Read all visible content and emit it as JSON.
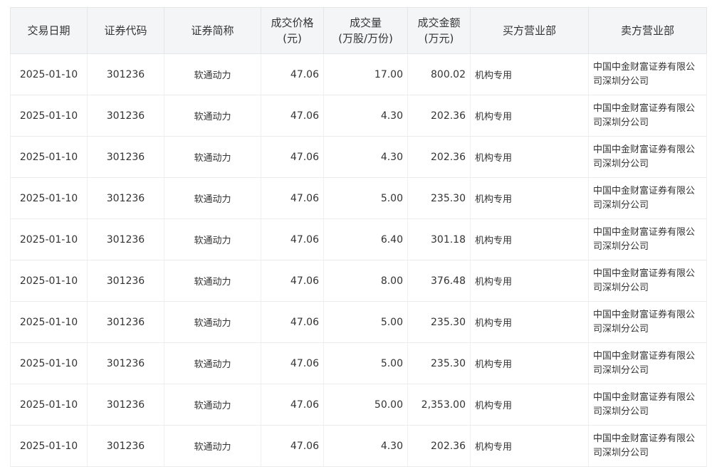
{
  "table": {
    "headers": [
      {
        "line1": "交易日期",
        "line2": ""
      },
      {
        "line1": "证券代码",
        "line2": ""
      },
      {
        "line1": "证券简称",
        "line2": ""
      },
      {
        "line1": "成交价格",
        "line2": "(元)"
      },
      {
        "line1": "成交量",
        "line2": "(万股/万份)"
      },
      {
        "line1": "成交金额",
        "line2": "(万元)"
      },
      {
        "line1": "买方营业部",
        "line2": ""
      },
      {
        "line1": "卖方营业部",
        "line2": ""
      }
    ],
    "rows": [
      {
        "date": "2025-01-10",
        "code": "301236",
        "name": "软通动力",
        "price": "47.06",
        "volume": "17.00",
        "amount": "800.02",
        "buyer": "机构专用",
        "seller": "中国中金财富证券有限公司深圳分公司"
      },
      {
        "date": "2025-01-10",
        "code": "301236",
        "name": "软通动力",
        "price": "47.06",
        "volume": "4.30",
        "amount": "202.36",
        "buyer": "机构专用",
        "seller": "中国中金财富证券有限公司深圳分公司"
      },
      {
        "date": "2025-01-10",
        "code": "301236",
        "name": "软通动力",
        "price": "47.06",
        "volume": "4.30",
        "amount": "202.36",
        "buyer": "机构专用",
        "seller": "中国中金财富证券有限公司深圳分公司"
      },
      {
        "date": "2025-01-10",
        "code": "301236",
        "name": "软通动力",
        "price": "47.06",
        "volume": "5.00",
        "amount": "235.30",
        "buyer": "机构专用",
        "seller": "中国中金财富证券有限公司深圳分公司"
      },
      {
        "date": "2025-01-10",
        "code": "301236",
        "name": "软通动力",
        "price": "47.06",
        "volume": "6.40",
        "amount": "301.18",
        "buyer": "机构专用",
        "seller": "中国中金财富证券有限公司深圳分公司"
      },
      {
        "date": "2025-01-10",
        "code": "301236",
        "name": "软通动力",
        "price": "47.06",
        "volume": "8.00",
        "amount": "376.48",
        "buyer": "机构专用",
        "seller": "中国中金财富证券有限公司深圳分公司"
      },
      {
        "date": "2025-01-10",
        "code": "301236",
        "name": "软通动力",
        "price": "47.06",
        "volume": "5.00",
        "amount": "235.30",
        "buyer": "机构专用",
        "seller": "中国中金财富证券有限公司深圳分公司"
      },
      {
        "date": "2025-01-10",
        "code": "301236",
        "name": "软通动力",
        "price": "47.06",
        "volume": "5.00",
        "amount": "235.30",
        "buyer": "机构专用",
        "seller": "中国中金财富证券有限公司深圳分公司"
      },
      {
        "date": "2025-01-10",
        "code": "301236",
        "name": "软通动力",
        "price": "47.06",
        "volume": "50.00",
        "amount": "2,353.00",
        "buyer": "机构专用",
        "seller": "中国中金财富证券有限公司深圳分公司"
      },
      {
        "date": "2025-01-10",
        "code": "301236",
        "name": "软通动力",
        "price": "47.06",
        "volume": "4.30",
        "amount": "202.36",
        "buyer": "机构专用",
        "seller": "中国中金财富证券有限公司深圳分公司"
      }
    ]
  }
}
